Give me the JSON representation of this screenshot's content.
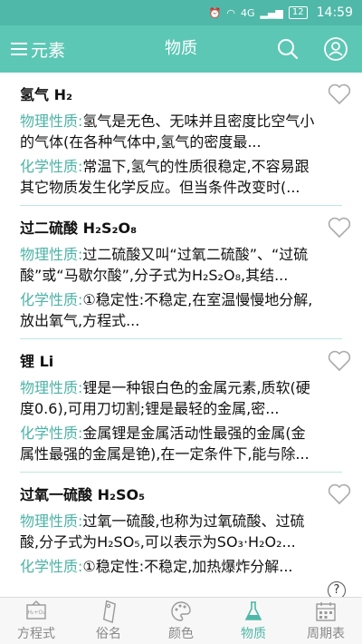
{
  "status": {
    "network": "4G",
    "battery": "12",
    "time": "14:59"
  },
  "header": {
    "left_label": "元素",
    "title": "物质"
  },
  "items": [
    {
      "name": "氢气 H₂",
      "physical_label": "物理性质:",
      "physical_text": "氢气是无色、无味并且密度比空气小的气体(在各种气体中,氢气的密度最...",
      "chemical_label": "化学性质:",
      "chemical_text": "常温下,氢气的性质很稳定,不容易跟其它物质发生化学反应。但当条件改变时(..."
    },
    {
      "name": "过二硫酸 H₂S₂O₈",
      "physical_label": "物理性质:",
      "physical_text": "过二硫酸又叫“过氧二硫酸”、“过硫酸”或“马歇尔酸”,分子式为H₂S₂O₈,其结...",
      "chemical_label": "化学性质:",
      "chemical_text": "①稳定性:不稳定,在室温慢慢地分解,放出氧气,方程式..."
    },
    {
      "name": "锂 Li",
      "physical_label": "物理性质:",
      "physical_text": "锂是一种银白色的金属元素,质软(硬度0.6),可用刀切割;锂是最轻的金属,密...",
      "chemical_label": "化学性质:",
      "chemical_text": "金属锂是金属活动性最强的金属(金属性最强的金属是铯),在一定条件下,能与除..."
    },
    {
      "name": "过氧一硫酸 H₂SO₅",
      "physical_label": "物理性质:",
      "physical_text": "过氧一硫酸,也称为过氧硫酸、过硫酸,分子式为H₂SO₅,可以表示为SO₃·H₂O₂...",
      "chemical_label": "化学性质:",
      "chemical_text": "①稳定性:不稳定,加热爆炸分解..."
    }
  ],
  "tabs": [
    {
      "label": "方程式",
      "icon": "equation-board-icon",
      "active": false
    },
    {
      "label": "俗名",
      "icon": "tag-icon",
      "active": false
    },
    {
      "label": "颜色",
      "icon": "palette-icon",
      "active": false
    },
    {
      "label": "物质",
      "icon": "flask-icon",
      "active": true
    },
    {
      "label": "周期表",
      "icon": "periodic-table-icon",
      "active": false
    }
  ],
  "tab_equation_text": "H₂+O₂",
  "help_label": "?",
  "colors": {
    "accent": "#5cc7b5",
    "label_teal": "#4db3a6",
    "divider": "#bfe6df"
  }
}
